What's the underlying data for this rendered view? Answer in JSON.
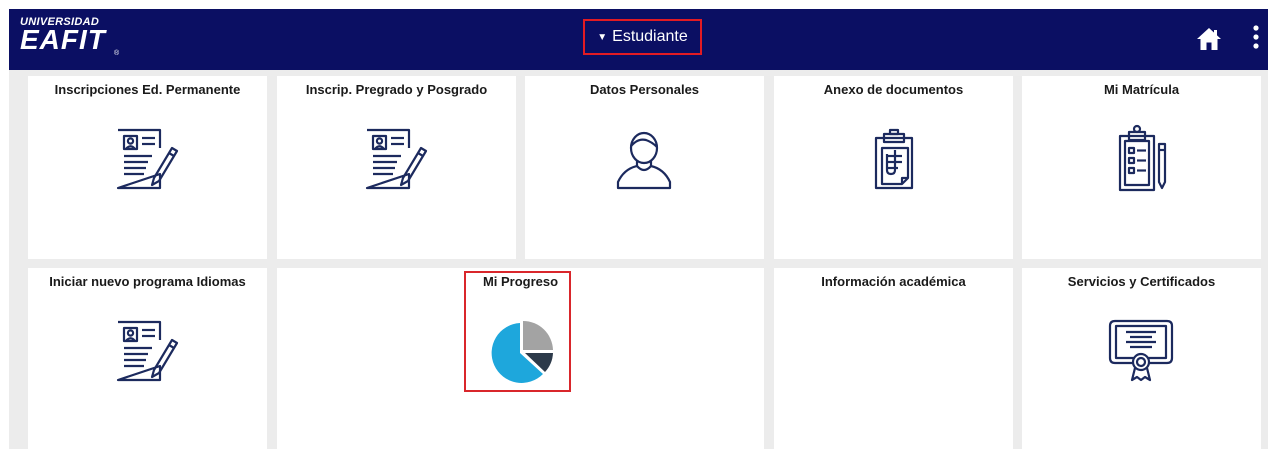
{
  "header": {
    "logo_top": "UNIVERSIDAD",
    "logo_main": "EAFIT",
    "logo_sub": "®",
    "role_selector": "Estudiante",
    "role_caret": "▼"
  },
  "tiles": [
    {
      "title": "Inscripciones Ed. Permanente",
      "icon": "form-edit-icon"
    },
    {
      "title": "Inscrip. Pregrado y Posgrado",
      "icon": "form-edit-icon"
    },
    {
      "title": "Datos Personales",
      "icon": "person-icon"
    },
    {
      "title": "Anexo de documentos",
      "icon": "clipboard-documents-icon"
    },
    {
      "title": "Mi Matrícula",
      "icon": "clipboard-list-icon"
    },
    {
      "title": "Iniciar nuevo programa Idiomas",
      "icon": "form-edit-icon"
    },
    {
      "title": "Mi Progreso",
      "icon": "pie-chart-icon"
    },
    {
      "title": "Información académica",
      "icon": ""
    },
    {
      "title": "Servicios y Certificados",
      "icon": "certificate-icon"
    }
  ],
  "colors": {
    "header_bg": "#0b0f63",
    "icon_navy": "#1c2a5e",
    "highlight": "#d9262b",
    "pie_blue": "#1ea7dc",
    "pie_gray": "#a3a3a3",
    "pie_dark": "#2c3a4a"
  }
}
